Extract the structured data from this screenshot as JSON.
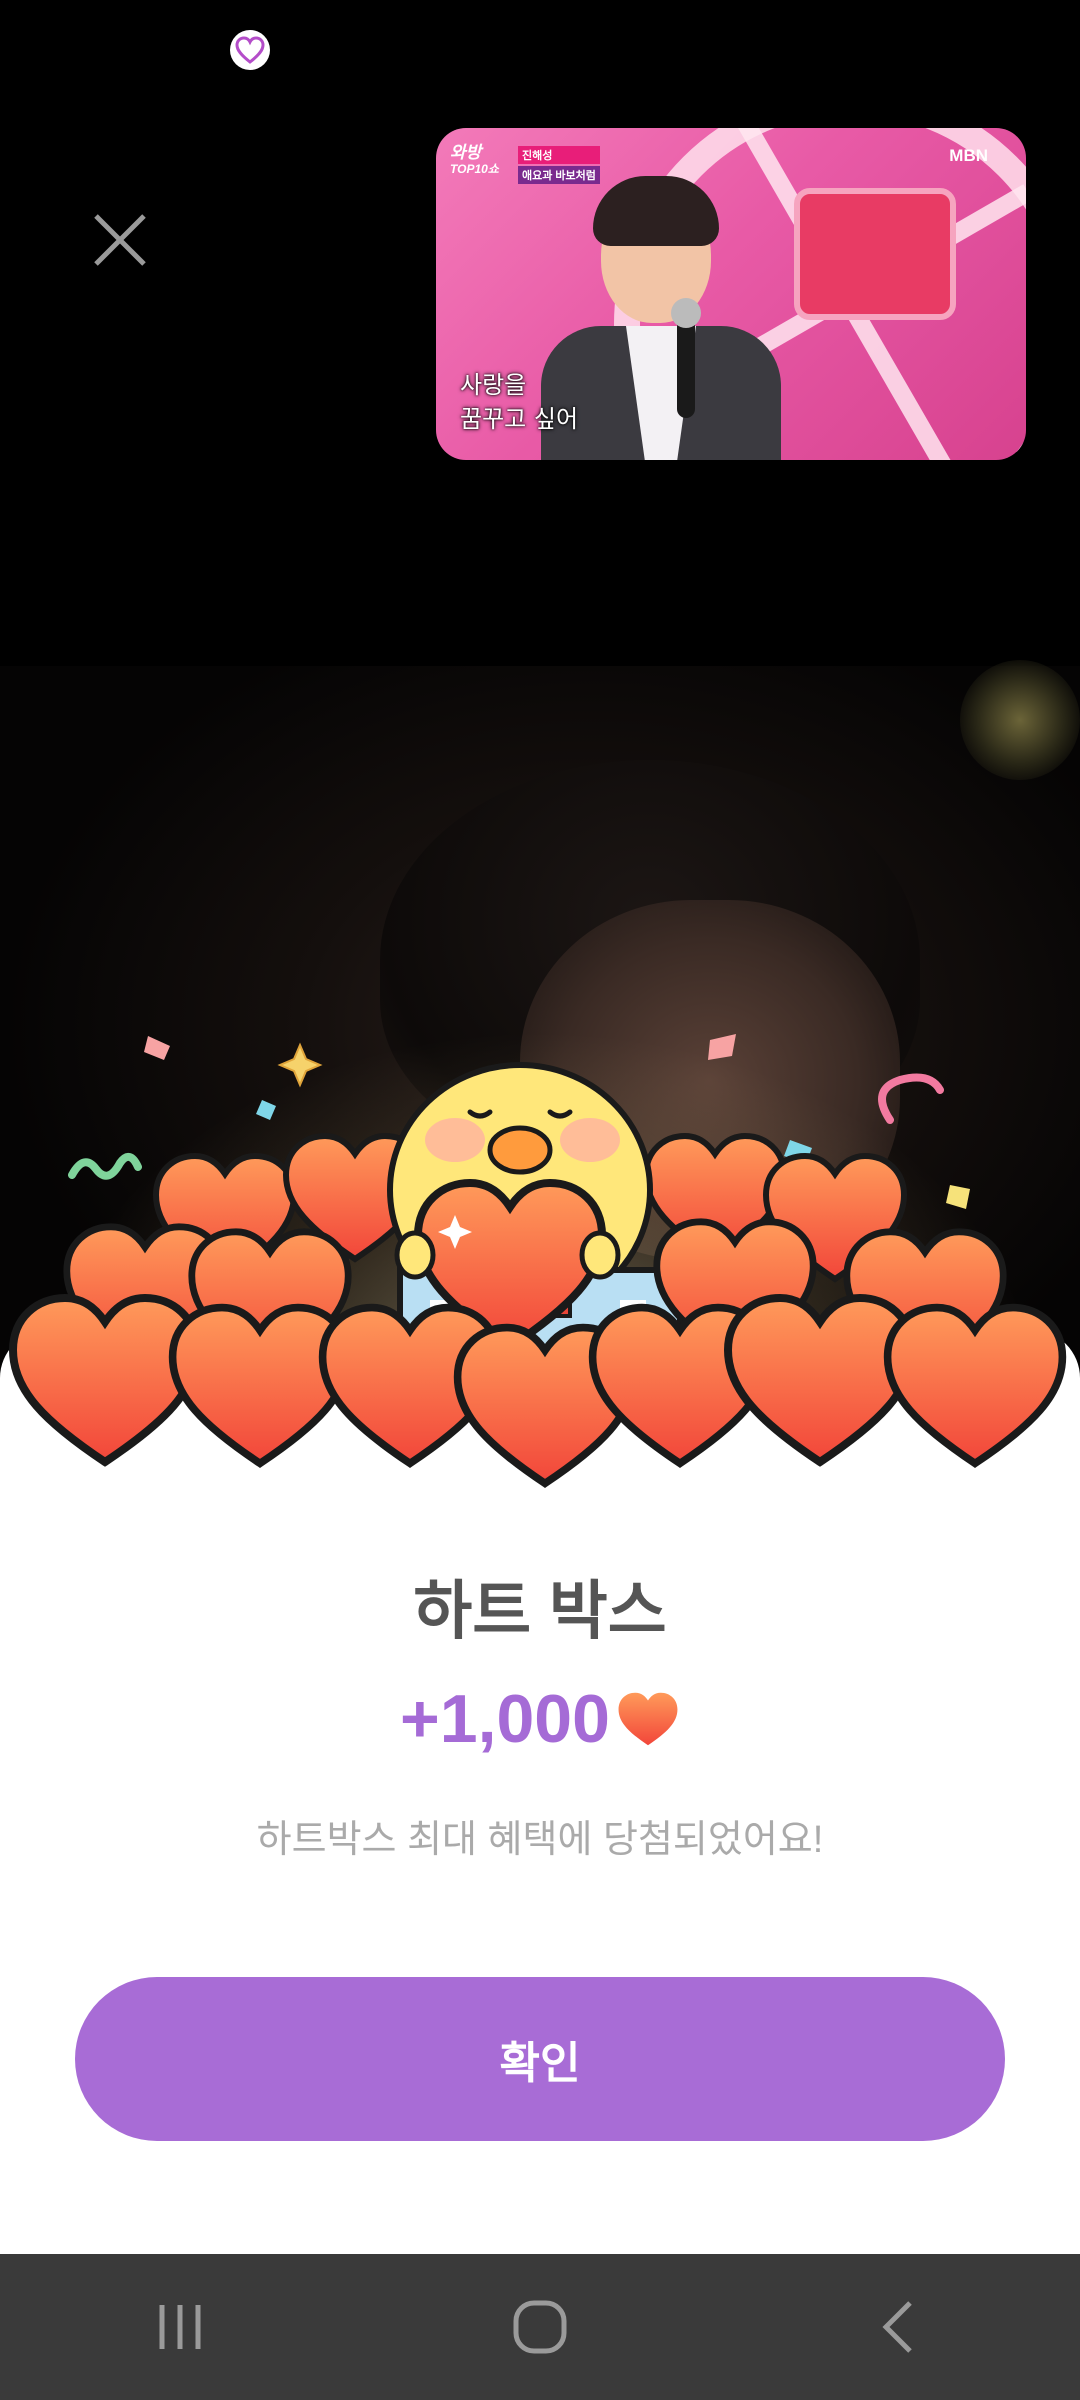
{
  "pip_video": {
    "show_logo": "와방",
    "show_logo_sub": "TOP10쇼",
    "tags": [
      "진해성",
      "애요과 바보처럼"
    ],
    "broadcaster": "MBN",
    "caption_lines": [
      "사랑을",
      "꿈꾸고 싶어"
    ]
  },
  "reward_popup": {
    "title": "하트 박스",
    "amount": "+1,000",
    "message": "하트박스 최대 혜택에 당첨되었어요!",
    "confirm_label": "확인"
  },
  "colors": {
    "accent_purple": "#a86cd6",
    "heart_red": "#f2553d",
    "heart_orange": "#ff8a4c",
    "chick_yellow": "#ffe77a"
  },
  "icons": {
    "status_app": "heart-app-icon",
    "close": "close-icon",
    "reward_heart": "heart-icon",
    "nav_recents": "recents-icon",
    "nav_home": "home-icon",
    "nav_back": "back-icon"
  }
}
